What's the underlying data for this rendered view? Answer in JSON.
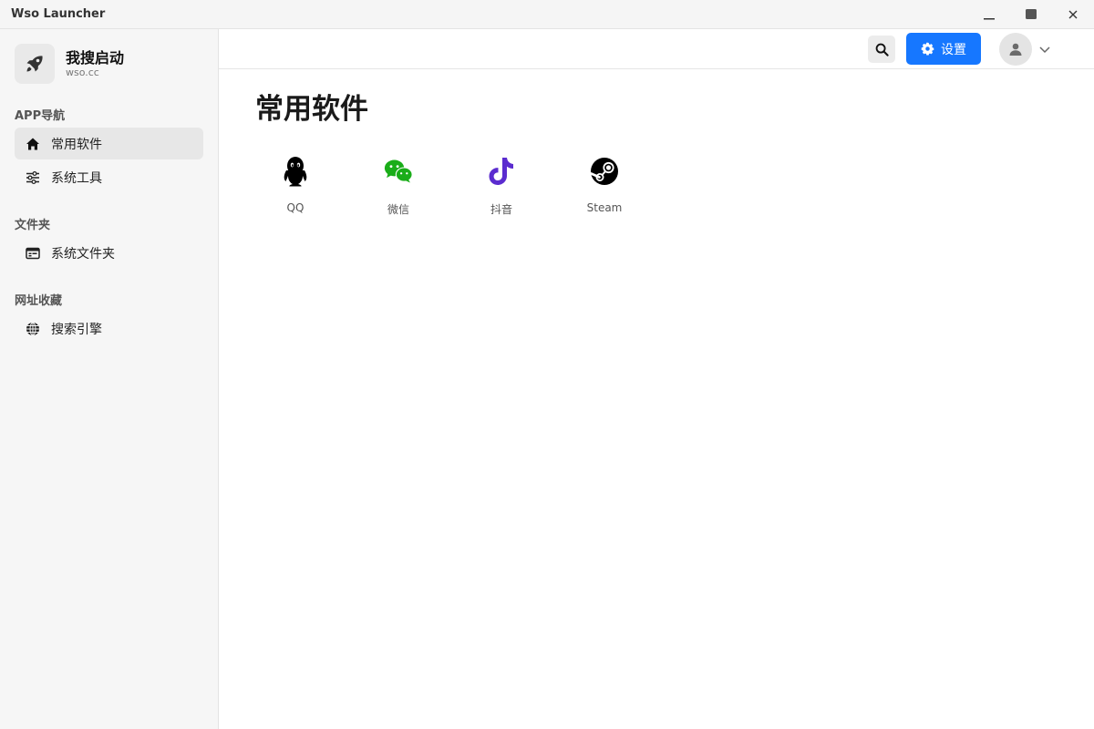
{
  "window": {
    "title": "Wso Launcher",
    "controls": [
      "minimize",
      "maximize",
      "close"
    ]
  },
  "sidebar": {
    "brand": {
      "name": "我搜启动",
      "domain": "wso.cc",
      "icon": "rocket-icon"
    },
    "sections": [
      {
        "title": "APP导航",
        "items": [
          {
            "label": "常用软件",
            "icon": "home-icon",
            "active": true
          },
          {
            "label": "系统工具",
            "icon": "sliders-icon",
            "active": false
          }
        ]
      },
      {
        "title": "文件夹",
        "items": [
          {
            "label": "系统文件夹",
            "icon": "folder-window-icon",
            "active": false
          }
        ]
      },
      {
        "title": "网址收藏",
        "items": [
          {
            "label": "搜索引擎",
            "icon": "globe-icon",
            "active": false
          }
        ]
      }
    ]
  },
  "header": {
    "search_icon": "search-icon",
    "settings_label": "设置",
    "settings_icon": "gear-icon",
    "avatar_icon": "user-icon",
    "accent_color": "#1677ff"
  },
  "main": {
    "title": "常用软件",
    "apps": [
      {
        "label": "QQ",
        "icon": "qq-penguin-icon",
        "color": "#000000"
      },
      {
        "label": "微信",
        "icon": "wechat-icon",
        "color": "#1aad19"
      },
      {
        "label": "抖音",
        "icon": "douyin-icon",
        "color": "#5b2ccf"
      },
      {
        "label": "Steam",
        "icon": "steam-icon",
        "color": "#000000"
      }
    ]
  }
}
